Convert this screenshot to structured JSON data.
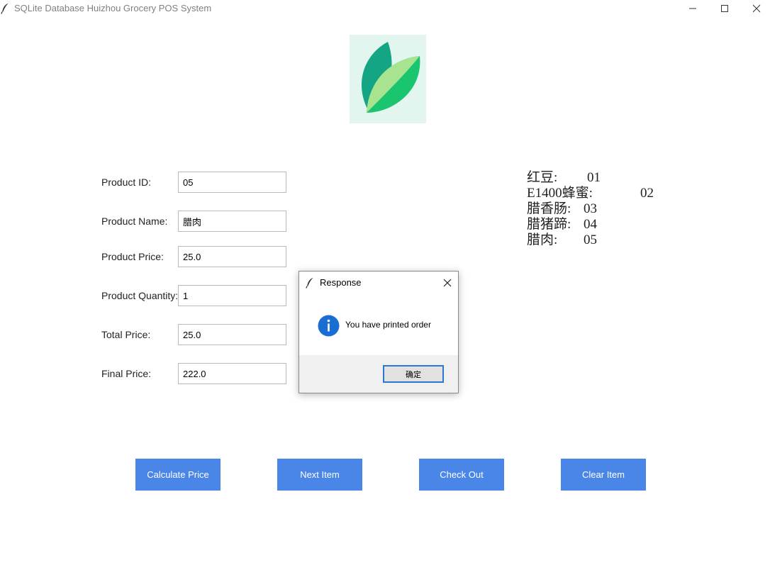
{
  "window": {
    "title": "SQLite Database Huizhou Grocery POS System"
  },
  "form": {
    "product_id": {
      "label": "Product ID:",
      "value": "05"
    },
    "product_name": {
      "label": "Product Name:",
      "value": "腊肉"
    },
    "product_price": {
      "label": "Product Price:",
      "value": "25.0"
    },
    "product_quantity": {
      "label": "Product Quantity:",
      "value": "1"
    },
    "total_price": {
      "label": "Total Price:",
      "value": "25.0"
    },
    "final_price": {
      "label": "Final Price:",
      "value": "222.0"
    }
  },
  "product_reference": [
    {
      "name": "红豆:",
      "code": "01"
    },
    {
      "name": "E1400蜂蜜:",
      "code": "02"
    },
    {
      "name": "腊香肠:",
      "code": "03"
    },
    {
      "name": "腊猪蹄:",
      "code": "04"
    },
    {
      "name": "腊肉:",
      "code": "05"
    }
  ],
  "buttons": {
    "calculate_price": "Calculate Price",
    "next_item": "Next Item",
    "check_out": "Check Out",
    "clear_item": "Clear Item"
  },
  "dialog": {
    "title": "Response",
    "message": "You have printed order",
    "ok_label": "确定"
  },
  "colors": {
    "button_blue": "#4a86e8",
    "logo_background": "#e3f5ef",
    "logo_leaf_dark": "#14a585",
    "logo_leaf_light": "#a8e490",
    "logo_leaf_green": "#19c56f",
    "info_icon": "#1a6ed3"
  },
  "icons": {
    "app": "feather-icon",
    "info": "info-icon",
    "close": "close-icon"
  }
}
